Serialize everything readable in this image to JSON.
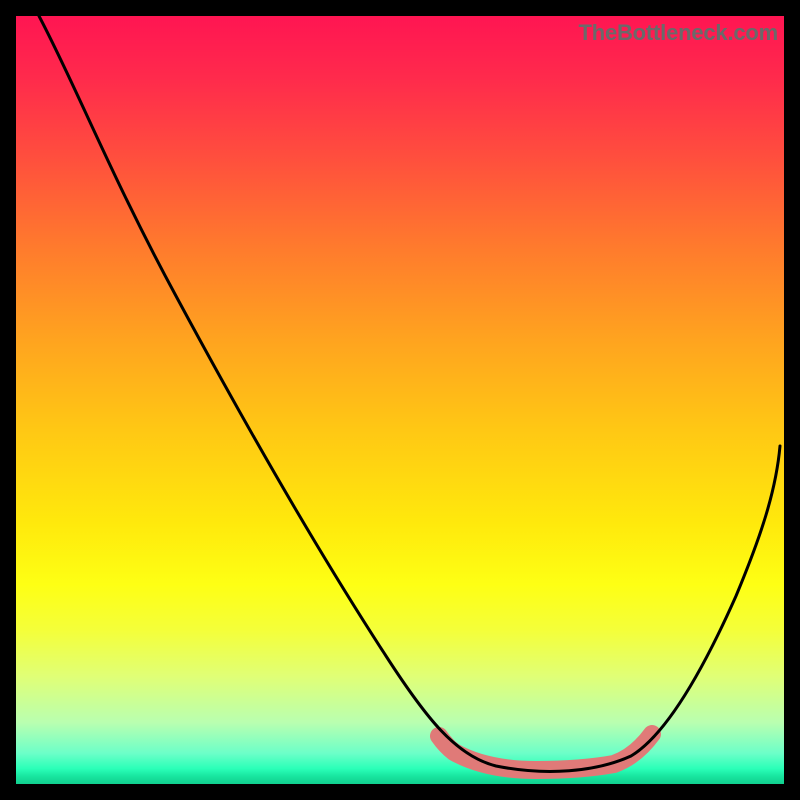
{
  "watermark": "TheBottleneck.com",
  "chart_data": {
    "type": "line",
    "title": "",
    "xlabel": "",
    "ylabel": "",
    "xlim": [
      0,
      100
    ],
    "ylim": [
      0,
      100
    ],
    "grid": false,
    "legend": false,
    "series": [
      {
        "name": "bottleneck-curve",
        "x": [
          3,
          10,
          20,
          30,
          40,
          48,
          55,
          58,
          62,
          68,
          74,
          78,
          82,
          90,
          99.5
        ],
        "y": [
          100,
          88,
          70,
          52,
          35,
          22,
          10,
          6,
          3,
          2,
          2,
          3,
          6,
          20,
          44
        ]
      }
    ],
    "flat_region": {
      "x_start": 55,
      "x_end": 85,
      "y_approx": 3,
      "color": "#e07a78"
    },
    "gradient_colors_top_to_bottom": [
      "#ff1552",
      "#ff4d3e",
      "#ffa31f",
      "#ffe90c",
      "#feff14",
      "#b9ffb0",
      "#2affb8",
      "#11cf8f"
    ]
  }
}
